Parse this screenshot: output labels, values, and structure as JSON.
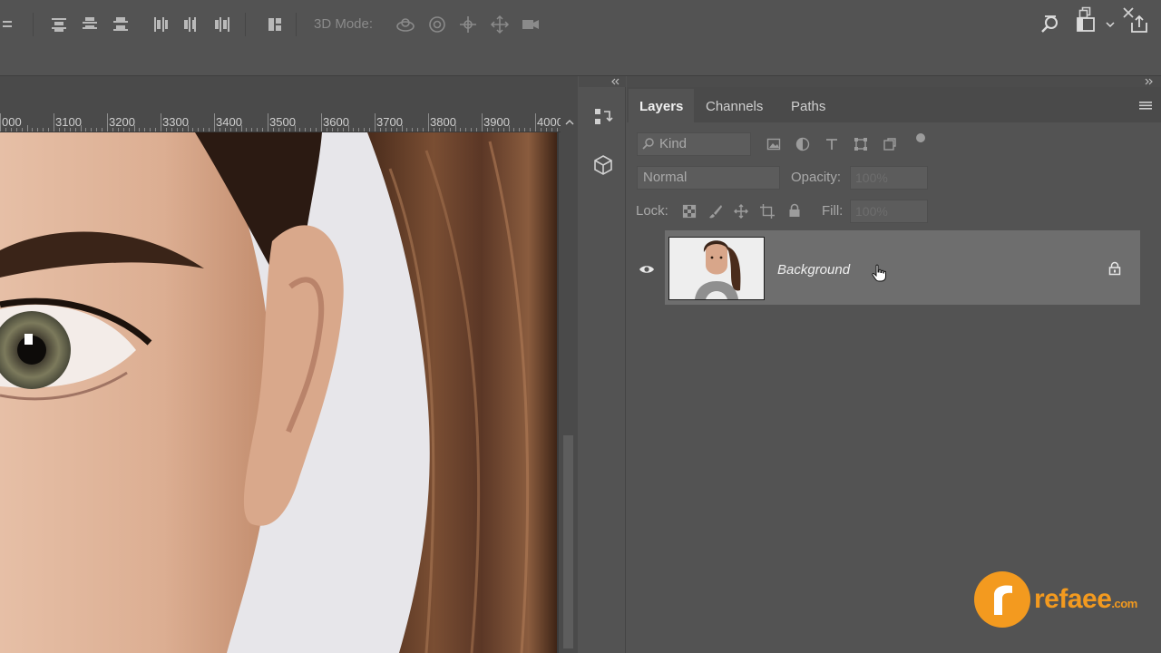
{
  "options_bar": {
    "mode_label": "3D Mode:"
  },
  "ruler": {
    "labels": [
      "000",
      "3100",
      "3200",
      "3300",
      "3400",
      "3500",
      "3600",
      "3700",
      "3800",
      "3900",
      "4000"
    ]
  },
  "panel": {
    "tabs": [
      "Layers",
      "Channels",
      "Paths"
    ],
    "active_tab": "Layers",
    "filter_label": "Kind",
    "blend_mode": "Normal",
    "opacity_label": "Opacity:",
    "opacity_value": "100%",
    "lock_label": "Lock:",
    "fill_label": "Fill:",
    "fill_value": "100%",
    "layers": [
      {
        "name": "Background",
        "visible": true,
        "locked": true
      }
    ]
  },
  "watermark": {
    "logo_letter": "r",
    "name": "refaee",
    "suffix": ".com"
  },
  "colors": {
    "ui_bg": "#535353",
    "selected_layer": "#6e6e6e",
    "brand_orange": "#f39a1f"
  }
}
